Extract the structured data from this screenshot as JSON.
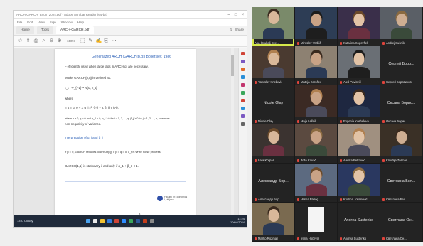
{
  "shared_screen": {
    "window_title": "ARCH-GARCH_Econ_2024.pdf - Adobe Acrobat Reader (64-bit)",
    "menu": [
      "File",
      "Edit",
      "View",
      "Sign",
      "Window",
      "Help"
    ],
    "tabs": [
      {
        "label": "Home",
        "active": false
      },
      {
        "label": "Tools",
        "active": false
      },
      {
        "label": "ARCH-GARCH.pdf",
        "active": true
      }
    ],
    "share_label": "Share",
    "zoom": "100%",
    "document": {
      "title": "Generalized ARCH (GARCH(p,q)) Bollerslev, 1986",
      "lines": [
        "– efficiently used when large lags in ARCH(q) are necessary.",
        "Model GARCH(p,q) is defined as:",
        "ε_t | Ψ_{t-1} ~ N(0, h_t)",
        "where",
        "h_t = α_0 + Σ α_i ε²_{t-i} + Σ β_j h_{t-j},",
        "where p ≥ 0, q > 0 and α_0 > 0, α_i ≥ 0 for i = 1, 2, ..., q, β_j ≥ 0 for j = 1, 2, ..., p, to ensure",
        "non-negativity of variance.",
        "Interpretation of α_i and β_j",
        "If p = 0, GARCH reduces to ARCH(q), if p = q = 0, ε_t is white noise process.",
        "GARCH(1,1) is stationary if and only if α_1 + β_1 < 1."
      ],
      "logo_text": "Faculty of Economics Ljubljana",
      "page_label": "2"
    },
    "taskbar": {
      "weather": "13°C Cloudy",
      "time": "11:24",
      "date": "10/04/2024"
    }
  },
  "participants": [
    {
      "name": "Ana Štrukelj Cer...",
      "video": true,
      "speaking": true,
      "muted": false
    },
    {
      "name": "Miroslav Verbič",
      "video": true,
      "speaking": false,
      "muted": true
    },
    {
      "name": "Katarina Kogovšek",
      "video": true,
      "speaking": false,
      "muted": true
    },
    {
      "name": "Andrej Sušnik",
      "video": true,
      "speaking": false,
      "muted": true
    },
    {
      "name": "Tomislav Knežević",
      "video": true,
      "speaking": false,
      "muted": true
    },
    {
      "name": "Mateja Korošec",
      "video": true,
      "speaking": false,
      "muted": true
    },
    {
      "name": "Aleš Pavlovič",
      "video": true,
      "speaking": false,
      "muted": true
    },
    {
      "name": "Сергей Боровиков",
      "video": false,
      "speaking": false,
      "muted": true,
      "display": "Сергей Боро..."
    },
    {
      "name": "Nicole Olay",
      "video": false,
      "speaking": false,
      "muted": true,
      "display": "Nicole Olay"
    },
    {
      "name": "Maja Lešnik",
      "video": true,
      "speaking": false,
      "muted": true
    },
    {
      "name": "Evgenia Kosheleva",
      "video": true,
      "speaking": false,
      "muted": true
    },
    {
      "name": "Оксана Борис...",
      "video": false,
      "speaking": false,
      "muted": true,
      "display": "Оксана Борис..."
    },
    {
      "name": "Lara Korpar",
      "video": true,
      "speaking": false,
      "muted": true
    },
    {
      "name": "Jože Kovač",
      "video": true,
      "speaking": false,
      "muted": true
    },
    {
      "name": "Alenka Petrovec",
      "video": true,
      "speaking": false,
      "muted": true
    },
    {
      "name": "Klavdija Zorman",
      "video": true,
      "speaking": false,
      "muted": true
    },
    {
      "name": "Александр Бор...",
      "video": false,
      "speaking": false,
      "muted": true,
      "display": "Александр Бор..."
    },
    {
      "name": "Vesna Prelog",
      "video": true,
      "speaking": false,
      "muted": true
    },
    {
      "name": "Kristina Jovanović",
      "video": true,
      "speaking": false,
      "muted": true
    },
    {
      "name": "Светлана Бел...",
      "video": false,
      "speaking": false,
      "muted": true,
      "display": "Светлана Бел..."
    },
    {
      "name": "Marko Rozman",
      "video": true,
      "speaking": false,
      "muted": true
    },
    {
      "name": "Irena Hočevar",
      "video": false,
      "speaking": false,
      "muted": true,
      "display": ""
    },
    {
      "name": "Andrea Sustenko",
      "video": false,
      "speaking": false,
      "muted": true,
      "display": "Andrea Sustenko"
    },
    {
      "name": "Светлана Он...",
      "video": false,
      "speaking": false,
      "muted": true,
      "display": "Светлана Он..."
    }
  ],
  "colors": {
    "speaking_outline": "#d6e84a",
    "muted_icon": "#e0443b",
    "doc_blue": "#2f63b8",
    "taskbar": "#1f2a3a",
    "gallery_bg": "#1a1a1a"
  }
}
